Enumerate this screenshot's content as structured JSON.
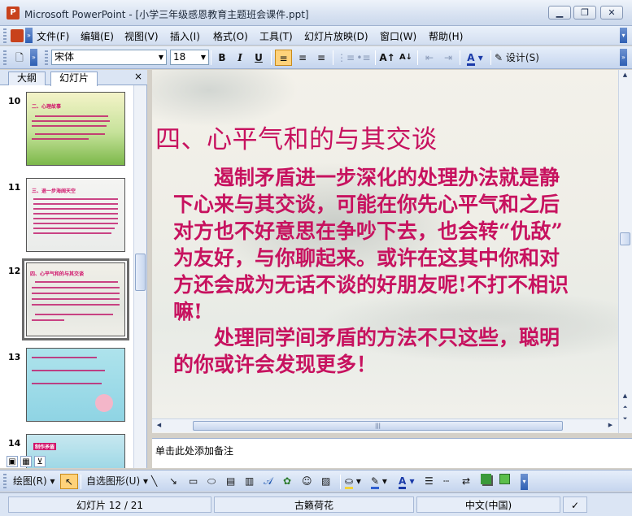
{
  "window": {
    "title": "Microsoft PowerPoint - [小学三年级感恩教育主题班会课件.ppt]",
    "app_icon": "powerpoint-icon",
    "controls": [
      "minimize-icon",
      "restore-icon",
      "close-icon"
    ]
  },
  "menu": {
    "items": [
      "文件(F)",
      "编辑(E)",
      "视图(V)",
      "插入(I)",
      "格式(O)",
      "工具(T)",
      "幻灯片放映(D)",
      "窗口(W)",
      "帮助(H)"
    ]
  },
  "toolbar": {
    "font_name": "宋体",
    "font_size": "18",
    "bold": "B",
    "italic": "I",
    "underline": "U",
    "design_label": "设计(S)"
  },
  "panel": {
    "tabs": [
      "大纲",
      "幻灯片"
    ],
    "active_tab": "幻灯片",
    "close_label": "×",
    "slide_numbers": [
      "10",
      "11",
      "12",
      "13",
      "14"
    ],
    "thumb_titles": {
      "10": "二、心理故事",
      "11": "三、退一步海阔天空",
      "12": "四、心平气和的与其交谈",
      "14": "制作矛盾"
    }
  },
  "slide": {
    "title": "四、心平气和的与其交谈",
    "paragraph1_lines": [
      "　　遏制矛盾进一步深化的处理办法就是静",
      "下心来与其交谈，可能在你先心平气和之后",
      "对方也不好意思在争吵下去，也会转“仇敌”",
      "为友好，与你聊起来。或许在这其中你和对",
      "方还会成为无话不谈的好朋友呢!不打不相识",
      "嘛!"
    ],
    "paragraph2_lines": [
      "　　处理同学间矛盾的方法不只这些，聪明",
      "的你或许会发现更多！"
    ],
    "text_color": "#c7125f"
  },
  "notes": {
    "placeholder": "单击此处添加备注"
  },
  "drawing_toolbar": {
    "draw_label": "绘图(R)",
    "autoshapes_label": "自选图形(U)"
  },
  "status": {
    "slide_info": "幻灯片 12 / 21",
    "design": "古籁荷花",
    "language": "中文(中国)"
  }
}
